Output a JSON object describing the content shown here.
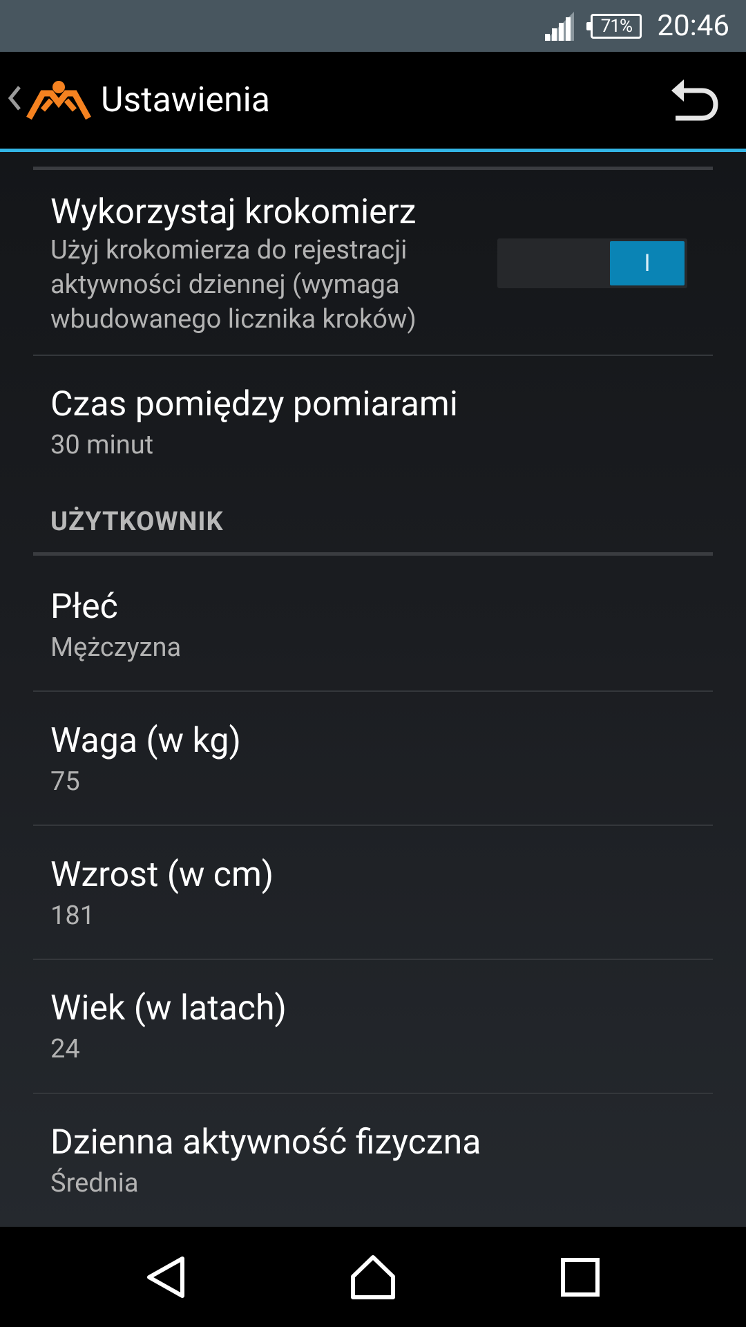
{
  "status_bar": {
    "battery": "71%",
    "time": "20:46"
  },
  "action_bar": {
    "title": "Ustawienia"
  },
  "pedometer": {
    "title": "Wykorzystaj krokomierz",
    "summary": "Użyj krokomierza do rejestracji aktywności dziennej (wymaga wbudowanego licznika kroków)",
    "toggle_label": "I",
    "enabled": true
  },
  "interval": {
    "title": "Czas pomiędzy pomiarami",
    "value": "30 minut"
  },
  "user_section": {
    "header": "UŻYTKOWNIK"
  },
  "gender": {
    "title": "Płeć",
    "value": "Mężczyzna"
  },
  "weight": {
    "title": "Waga (w kg)",
    "value": "75"
  },
  "height": {
    "title": "Wzrost (w cm)",
    "value": "181"
  },
  "age": {
    "title": "Wiek (w latach)",
    "value": "24"
  },
  "activity": {
    "title": "Dzienna aktywność fizyczna",
    "value": "Średnia"
  },
  "colors": {
    "accent": "#33b5e5",
    "toggle_on": "#0a84b5",
    "logo": "#f58220"
  }
}
